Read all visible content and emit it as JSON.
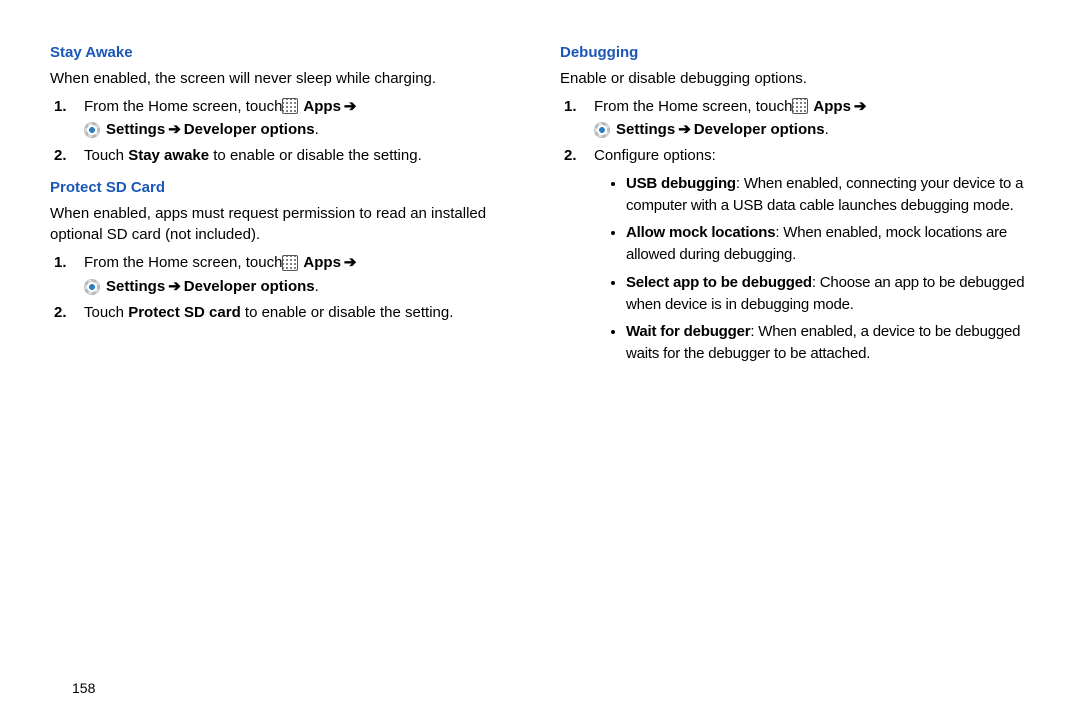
{
  "pageNumber": "158",
  "arrow": "➔",
  "left": {
    "stayAwake": {
      "title": "Stay Awake",
      "desc": "When enabled, the screen will never sleep while charging.",
      "step1_num": "1.",
      "step1_prefix": "From the Home screen, touch ",
      "step1_apps": "Apps",
      "step1_settings": "Settings",
      "step1_devopts": "Developer options",
      "step2_num": "2.",
      "step2_a": "Touch ",
      "step2_b": "Stay awake",
      "step2_c": " to enable or disable the setting."
    },
    "protectSD": {
      "title": "Protect SD Card",
      "desc": "When enabled, apps must request permission to read an installed optional SD card (not included).",
      "step1_num": "1.",
      "step1_prefix": "From the Home screen, touch ",
      "step1_apps": "Apps",
      "step1_settings": "Settings",
      "step1_devopts": "Developer options",
      "step2_num": "2.",
      "step2_a": "Touch ",
      "step2_b": "Protect SD card",
      "step2_c": " to enable or disable the setting."
    }
  },
  "right": {
    "debugging": {
      "title": "Debugging",
      "desc": "Enable or disable debugging options.",
      "step1_num": "1.",
      "step1_prefix": "From the Home screen, touch ",
      "step1_apps": "Apps",
      "step1_settings": "Settings",
      "step1_devopts": "Developer options",
      "step2_num": "2.",
      "step2_text": "Configure options:",
      "bullets": {
        "b1_term": "USB debugging",
        "b1_body": ": When enabled, connecting your device to a computer with a USB data cable launches debugging mode.",
        "b2_term": "Allow mock locations",
        "b2_body": ": When enabled, mock locations are allowed during debugging.",
        "b3_term": "Select app to be debugged",
        "b3_body": ": Choose an app to be debugged when device is in debugging mode.",
        "b4_term": "Wait for debugger",
        "b4_body": ": When enabled, a device to be debugged waits for the debugger to be attached."
      }
    }
  }
}
